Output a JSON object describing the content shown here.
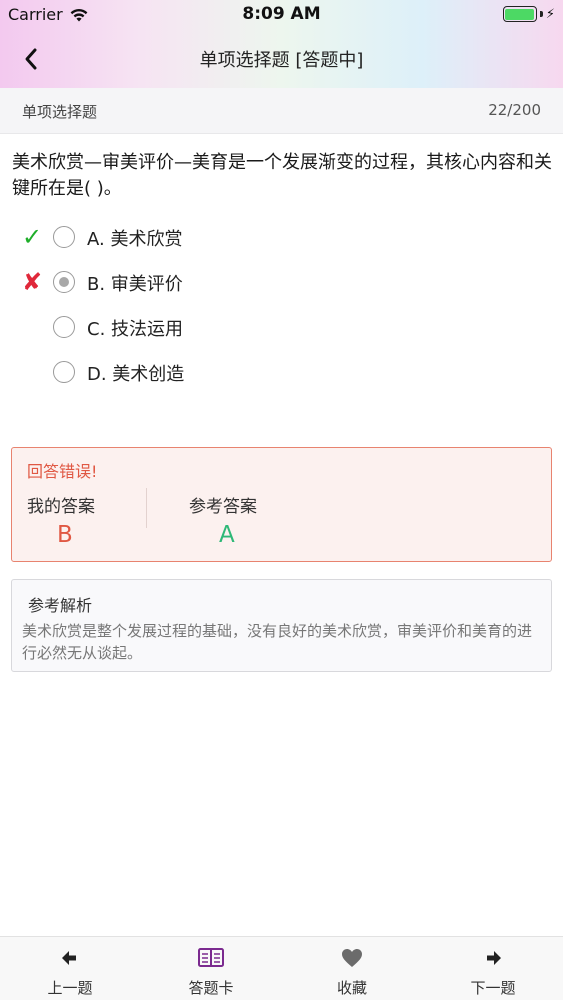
{
  "status_bar": {
    "carrier": "Carrier",
    "time": "8:09 AM"
  },
  "nav": {
    "title": "单项选择题 [答题中]",
    "back_icon": "chevron-left-icon"
  },
  "subheader": {
    "question_type": "单项选择题",
    "progress": "22/200"
  },
  "question": {
    "text": "美术欣赏—审美评价—美育是一个发展渐变的过程，其核心内容和关键所在是(    )。",
    "options": [
      {
        "label": "A. 美术欣赏",
        "mark": "✓",
        "mark_color": "#1fae2a",
        "selected": false
      },
      {
        "label": "B. 审美评价",
        "mark": "✘",
        "mark_color": "#e0283a",
        "selected": true
      },
      {
        "label": "C. 技法运用",
        "mark": "",
        "mark_color": "",
        "selected": false
      },
      {
        "label": "D. 美术创造",
        "mark": "",
        "mark_color": "",
        "selected": false
      }
    ]
  },
  "result": {
    "heading": "回答错误!",
    "my_answer_label": "我的答案",
    "my_answer_value": "B",
    "reference_label": "参考答案",
    "reference_value": "A",
    "colors": {
      "wrong": "#e05843",
      "correct": "#2fb877"
    }
  },
  "analysis": {
    "heading": "参考解析",
    "text": "美术欣赏是整个发展过程的基础，没有良好的美术欣赏，审美评价和美育的进行必然无从谈起。"
  },
  "tabbar": {
    "items": [
      {
        "label": "上一题",
        "icon": "arrow-left-icon"
      },
      {
        "label": "答题卡",
        "icon": "book-icon"
      },
      {
        "label": "收藏",
        "icon": "heart-icon"
      },
      {
        "label": "下一题",
        "icon": "arrow-right-icon"
      }
    ]
  }
}
